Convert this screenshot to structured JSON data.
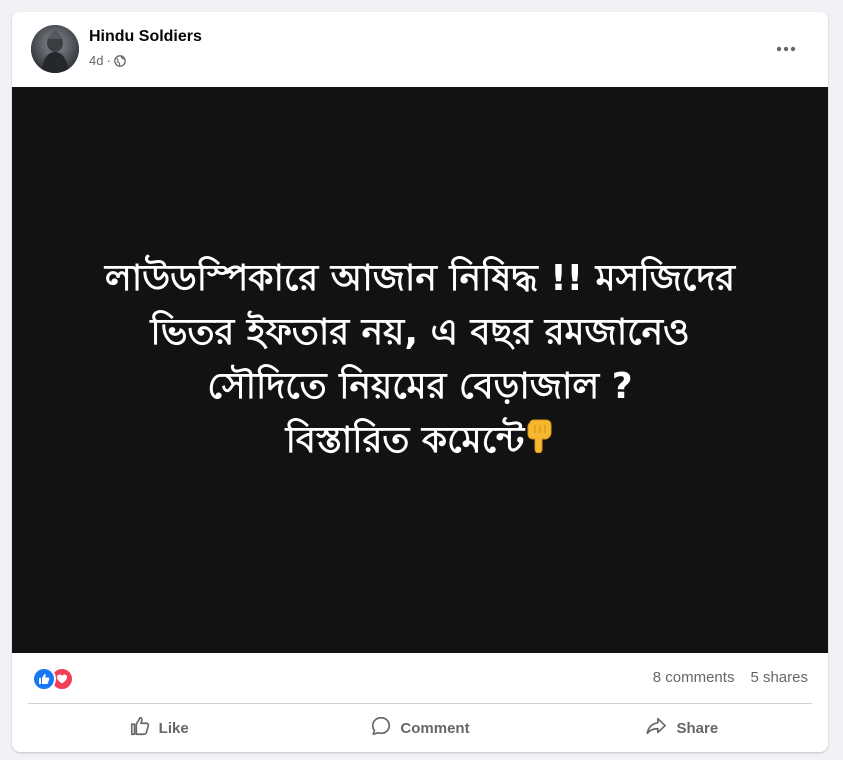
{
  "post": {
    "author": "Hindu Soldiers",
    "time": "4d",
    "separator": "·",
    "audience_icon": "globe-icon",
    "more_icon": "more-horizontal-icon",
    "media": {
      "background": "#121212",
      "lines": [
        "লাউডস্পিকারে আজান নিষিদ্ধ !! মসজিদের",
        "ভিতর ইফতার নয়, এ বছর রমজানেও",
        "সৌদিতে নিয়মের বেড়াজাল ?",
        "বিস্তারিত কমেন্টে"
      ],
      "trailing_emoji": "backhand-index-pointing-down-icon"
    },
    "reactions": [
      "like-reaction-icon",
      "love-reaction-icon"
    ],
    "comments": "8 comments",
    "shares": "5 shares"
  },
  "actions": {
    "like": "Like",
    "comment": "Comment",
    "share": "Share"
  },
  "colors": {
    "page_bg": "#f0f2f5",
    "card_bg": "#ffffff",
    "secondary_text": "#65676b",
    "like_blue": "#1877f2",
    "love_red": "#f33e58"
  }
}
